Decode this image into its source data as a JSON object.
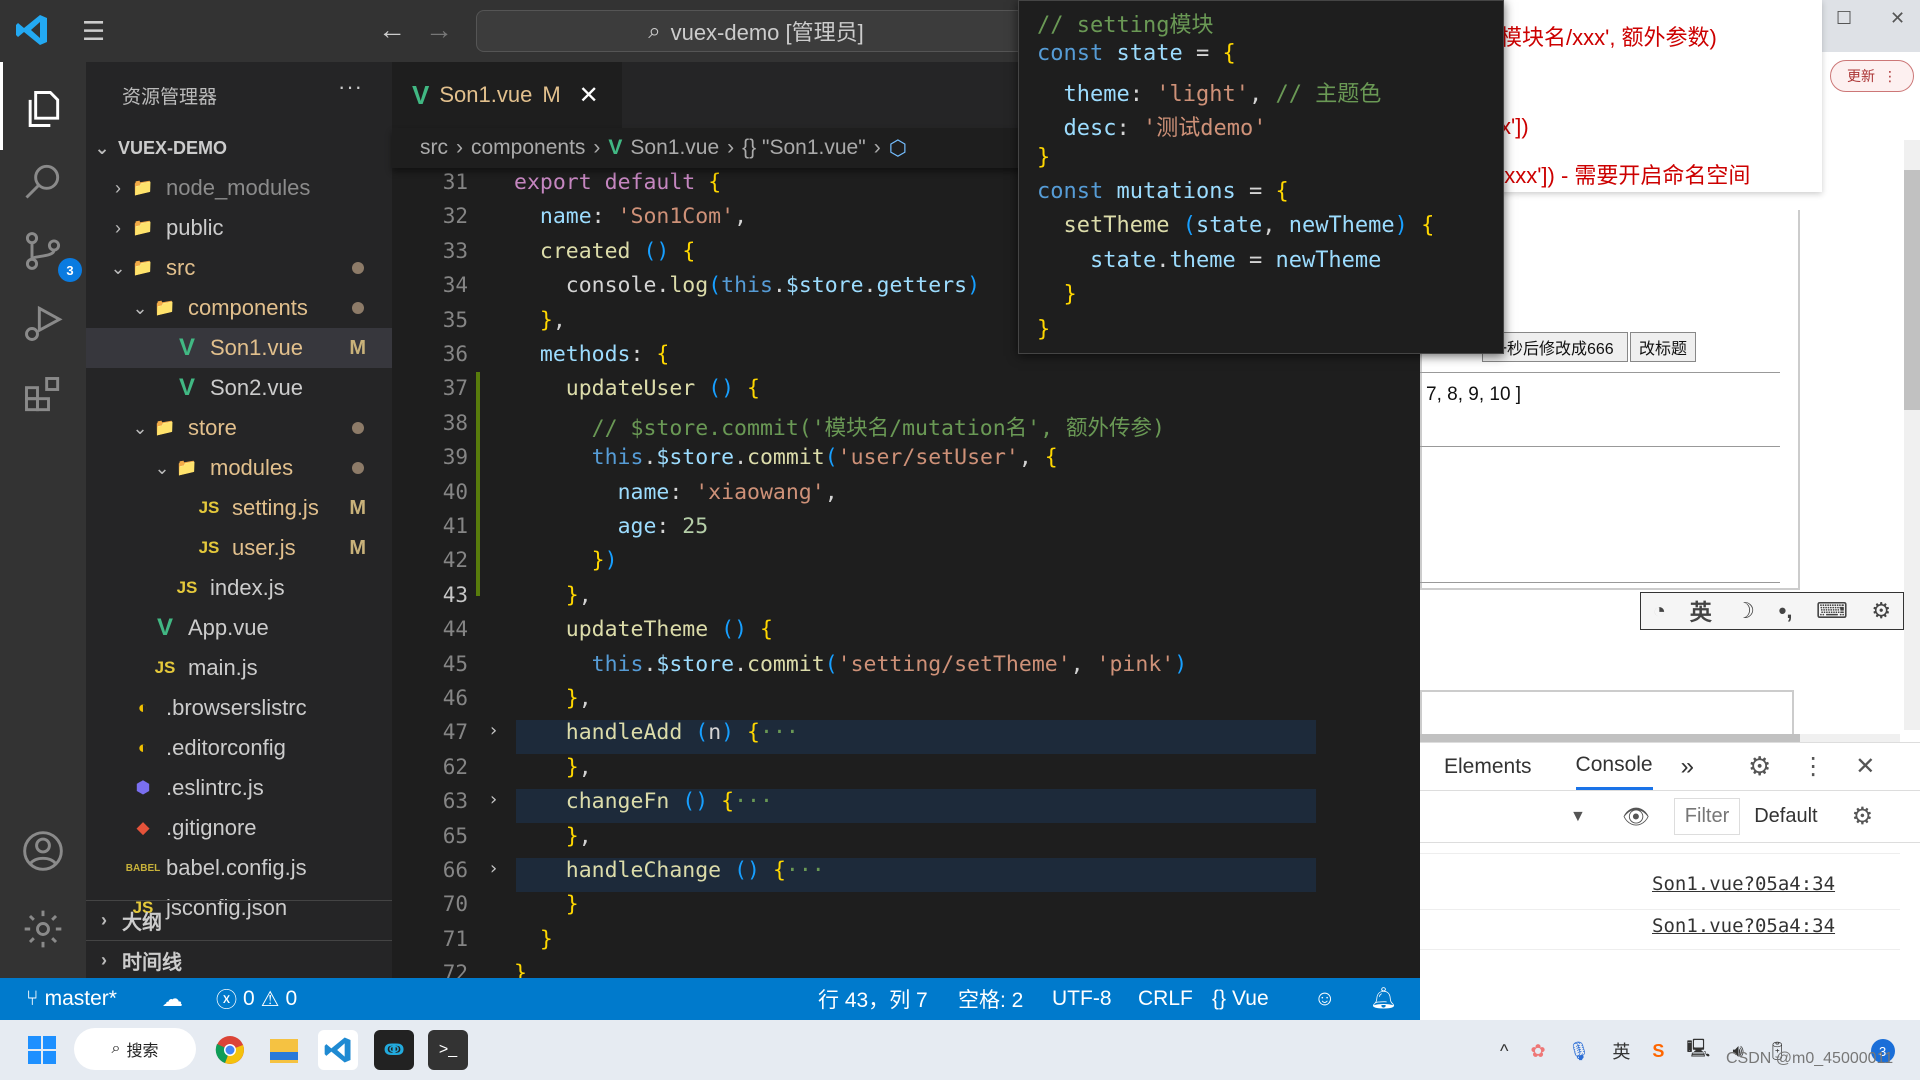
{
  "titlebar": {
    "command_center": "vuex-demo [管理员]"
  },
  "activity_bar": {
    "items": [
      "explorer",
      "search",
      "source-control",
      "run-debug",
      "extensions",
      "accounts",
      "manage"
    ],
    "source_control_badge": "3"
  },
  "sidebar": {
    "title": "资源管理器",
    "more": "···",
    "project": "VUEX-DEMO",
    "tree": [
      {
        "label": "node_modules",
        "type": "folder",
        "expanded": false,
        "status": ""
      },
      {
        "label": "public",
        "type": "folder",
        "expanded": false,
        "status": ""
      },
      {
        "label": "src",
        "type": "folder",
        "expanded": true,
        "status": "dot"
      },
      {
        "label": "components",
        "type": "folder",
        "expanded": true,
        "status": "dot"
      },
      {
        "label": "Son1.vue",
        "type": "vue",
        "status": "M",
        "selected": true
      },
      {
        "label": "Son2.vue",
        "type": "vue",
        "status": ""
      },
      {
        "label": "store",
        "type": "folder",
        "expanded": true,
        "status": "dot"
      },
      {
        "label": "modules",
        "type": "folder",
        "expanded": true,
        "status": "dot"
      },
      {
        "label": "setting.js",
        "type": "js",
        "status": "M"
      },
      {
        "label": "user.js",
        "type": "js",
        "status": "M"
      },
      {
        "label": "index.js",
        "type": "js",
        "status": ""
      },
      {
        "label": "App.vue",
        "type": "vue",
        "status": ""
      },
      {
        "label": "main.js",
        "type": "js",
        "status": ""
      },
      {
        "label": ".browserslistrc",
        "type": "config",
        "status": ""
      },
      {
        "label": ".editorconfig",
        "type": "config",
        "status": ""
      },
      {
        "label": ".eslintrc.js",
        "type": "eslint",
        "status": ""
      },
      {
        "label": ".gitignore",
        "type": "git",
        "status": ""
      },
      {
        "label": "babel.config.js",
        "type": "babel",
        "status": ""
      },
      {
        "label": "jsconfig.json",
        "type": "js",
        "status": ""
      }
    ],
    "outline": "大纲",
    "timeline": "时间线"
  },
  "editor": {
    "tab": {
      "label": "Son1.vue",
      "status": "M"
    },
    "breadcrumb": [
      "src",
      "components",
      "Son1.vue",
      "{} \"Son1.vue\""
    ],
    "current_line": "43",
    "lines": [
      {
        "n": "31",
        "t": "export default {"
      },
      {
        "n": "32",
        "t": "  name: 'Son1Com',"
      },
      {
        "n": "33",
        "t": "  created () {"
      },
      {
        "n": "34",
        "t": "    console.log(this.$store.getters)"
      },
      {
        "n": "35",
        "t": "  },"
      },
      {
        "n": "36",
        "t": "  methods: {"
      },
      {
        "n": "37",
        "t": "    updateUser () {"
      },
      {
        "n": "38",
        "t": "      // $store.commit('模块名/mutation名', 额外传参)"
      },
      {
        "n": "39",
        "t": "      this.$store.commit('user/setUser', {"
      },
      {
        "n": "40",
        "t": "        name: 'xiaowang',"
      },
      {
        "n": "41",
        "t": "        age: 25"
      },
      {
        "n": "42",
        "t": "      })"
      },
      {
        "n": "43",
        "t": "    },"
      },
      {
        "n": "44",
        "t": "    updateTheme () {"
      },
      {
        "n": "45",
        "t": "      this.$store.commit('setting/setTheme', 'pink')"
      },
      {
        "n": "46",
        "t": "    },"
      },
      {
        "n": "47",
        "t": "    handleAdd (n) {···",
        "folded": true
      },
      {
        "n": "62",
        "t": "    },"
      },
      {
        "n": "63",
        "t": "    changeFn () {···",
        "folded": true
      },
      {
        "n": "65",
        "t": "    },"
      },
      {
        "n": "66",
        "t": "    handleChange () {···",
        "folded": true
      },
      {
        "n": "70",
        "t": "    }"
      },
      {
        "n": "71",
        "t": "  }"
      },
      {
        "n": "72",
        "t": "}"
      }
    ]
  },
  "hover_popup": {
    "lines": [
      "// setting模块",
      "const state = {",
      "  theme: 'light', // 主题色",
      "  desc: '测试demo'",
      "}",
      "const mutations = {",
      "  setTheme (state, newTheme) {",
      "    state.theme = newTheme",
      "  }",
      "}"
    ]
  },
  "browser": {
    "hint_lines": [
      "模块名/xxx', 额外参数)",
      "x'])",
      "'xxx']) - 需要开启命名空间"
    ],
    "update_button": "更新",
    "buttons": [
      "一秒后修改成666",
      "改标题"
    ],
    "array_text": "7, 8, 9, 10 ]",
    "ime_toolbar": [
      "英",
      "☽",
      "•,",
      "⌨",
      "⚙"
    ]
  },
  "devtools": {
    "tabs": [
      "Elements",
      "Console"
    ],
    "active_tab": "Console",
    "more": "»",
    "filter_placeholder": "Filter",
    "levels": "Default",
    "logs": [
      "Son1.vue?05a4:34",
      "Son1.vue?05a4:34"
    ]
  },
  "statusbar": {
    "branch": "master*",
    "errors": "0",
    "warnings": "0",
    "position": "行 43，列 7",
    "indent": "空格: 2",
    "encoding": "UTF-8",
    "eol": "CRLF",
    "language": "Vue"
  },
  "taskbar": {
    "search": "搜索",
    "ime": "英",
    "notification_count": "3",
    "watermark": "CSDN @m0_45000011"
  }
}
